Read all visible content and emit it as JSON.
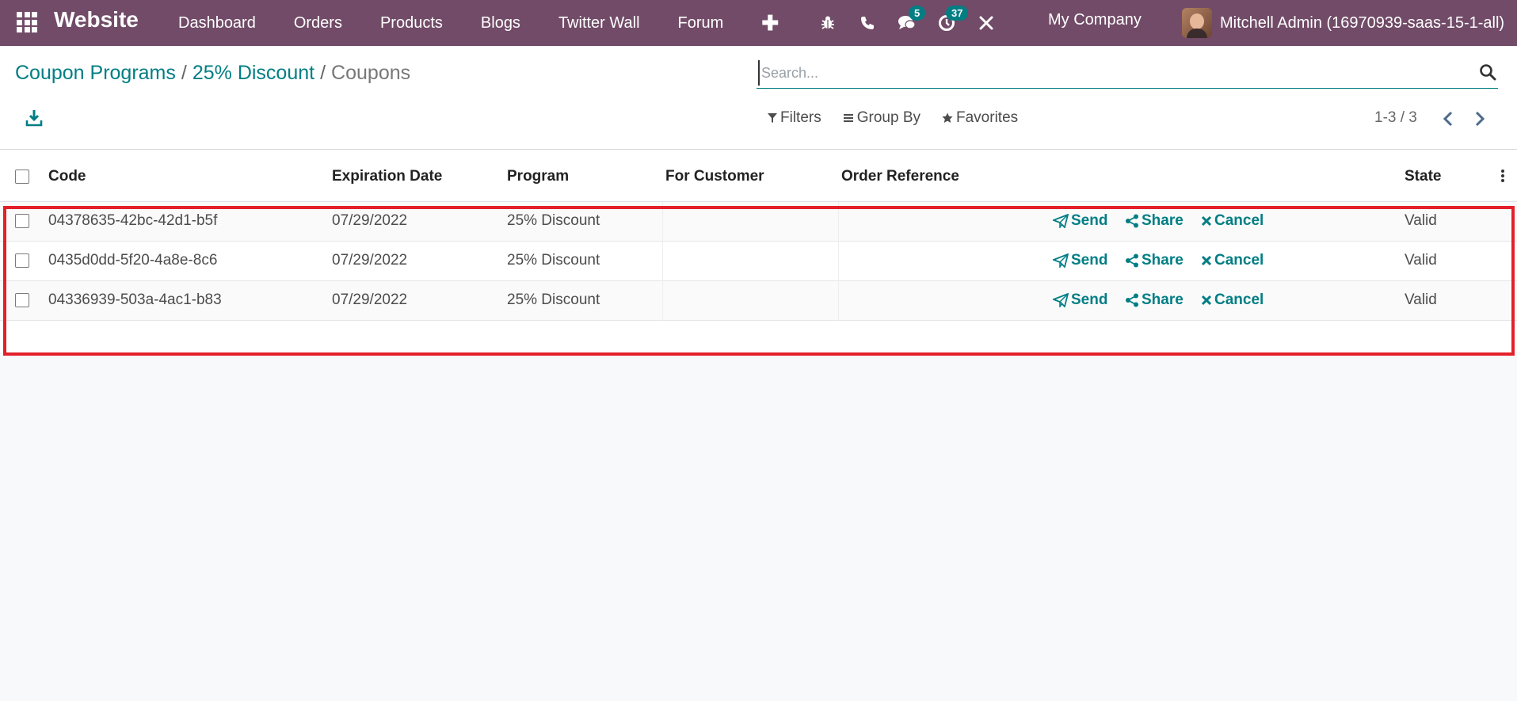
{
  "navbar": {
    "brand": "Website",
    "menu": [
      "Dashboard",
      "Orders",
      "Products",
      "Blogs",
      "Twitter Wall",
      "Forum"
    ],
    "messages_badge": "5",
    "activities_badge": "37",
    "company": "My Company",
    "user": "Mitchell Admin (16970939-saas-15-1-all)"
  },
  "breadcrumb": {
    "items": [
      "Coupon Programs",
      "25% Discount"
    ],
    "separator": "/",
    "active": "Coupons"
  },
  "search": {
    "placeholder": "Search..."
  },
  "search_options": {
    "filters": "Filters",
    "group_by": "Group By",
    "favorites": "Favorites"
  },
  "pager": {
    "value": "1-3 / 3"
  },
  "table": {
    "columns": {
      "code": "Code",
      "expiration_date": "Expiration Date",
      "program": "Program",
      "for_customer": "For Customer",
      "order_reference": "Order Reference",
      "state": "State"
    },
    "actions": {
      "send": "Send",
      "share": "Share",
      "cancel": "Cancel"
    },
    "rows": [
      {
        "code": "04378635-42bc-42d1-b5f",
        "expiration_date": "07/29/2022",
        "program": "25% Discount",
        "for_customer": "",
        "order_reference": "",
        "state": "Valid"
      },
      {
        "code": "0435d0dd-5f20-4a8e-8c6",
        "expiration_date": "07/29/2022",
        "program": "25% Discount",
        "for_customer": "",
        "order_reference": "",
        "state": "Valid"
      },
      {
        "code": "04336939-503a-4ac1-b83",
        "expiration_date": "07/29/2022",
        "program": "25% Discount",
        "for_customer": "",
        "order_reference": "",
        "state": "Valid"
      }
    ]
  },
  "colors": {
    "navbar": "#714b67",
    "accent": "#017e84",
    "highlight": "#e3202a"
  }
}
